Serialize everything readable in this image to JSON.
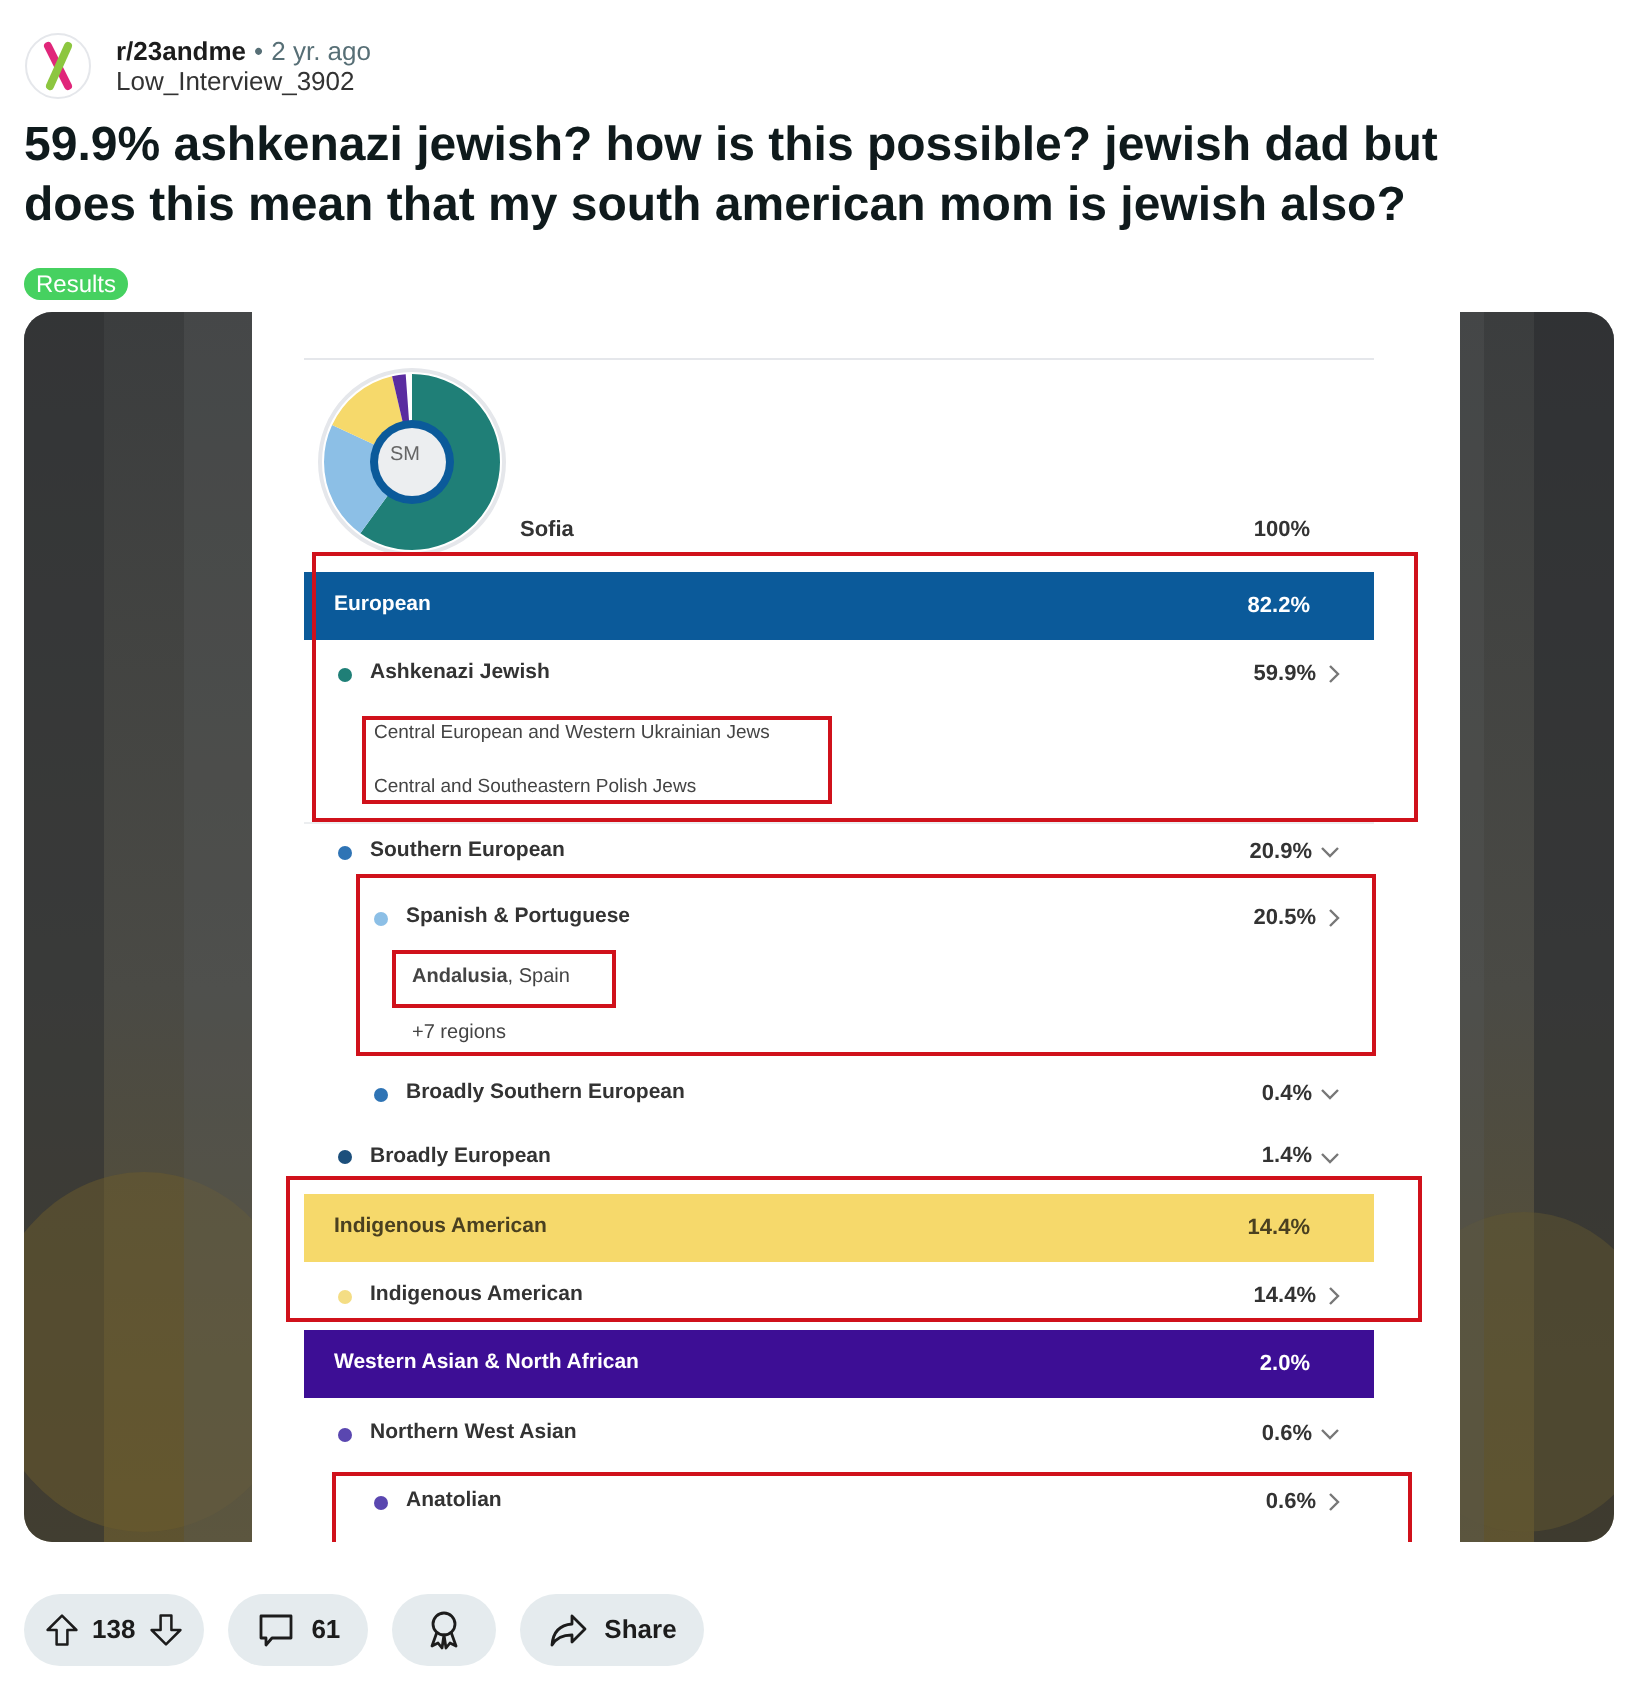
{
  "post": {
    "subreddit": "r/23andme",
    "separator": "•",
    "time": "2 yr. ago",
    "author": "Low_Interview_3902",
    "title": "59.9% ashkenazi jewish? how is this possible? jewish dad but does this mean that my south american mom is jewish also?",
    "flair": "Results"
  },
  "screenshot": {
    "initials": "SM",
    "name": "Sofia",
    "total": "100%",
    "sections": [
      {
        "label": "European",
        "percent": "82.2%",
        "color": "#0b5a9a",
        "light_text": true,
        "children": [
          {
            "kind": "population",
            "label": "Ashkenazi Jewish",
            "percent": "59.9%",
            "color": "#1f7f77",
            "expanded": false,
            "children": [
              {
                "kind": "region",
                "label": "Central European and Western Ukrainian Jews"
              },
              {
                "kind": "region",
                "label": "Central and Southeastern Polish Jews"
              }
            ]
          },
          {
            "kind": "population",
            "label": "Southern European",
            "percent": "20.9%",
            "color": "#2f74b5",
            "expanded": true,
            "children": [
              {
                "kind": "population",
                "label": "Spanish & Portuguese",
                "percent": "20.5%",
                "color": "#8cbfe6",
                "expanded": false,
                "children": [
                  {
                    "kind": "place",
                    "label": "**Andalusia**, Spain"
                  },
                  {
                    "kind": "more",
                    "label": "+7 regions"
                  }
                ]
              },
              {
                "kind": "population",
                "label": "Broadly Southern European",
                "percent": "0.4%",
                "color": "#2f74b5",
                "expanded": true
              }
            ]
          },
          {
            "kind": "population",
            "label": "Broadly European",
            "percent": "1.4%",
            "color": "#1c4f7c",
            "expanded": true
          }
        ]
      },
      {
        "label": "Indigenous American",
        "percent": "14.4%",
        "color": "#f6d96b",
        "light_text": false,
        "children": [
          {
            "kind": "population",
            "label": "Indigenous American",
            "percent": "14.4%",
            "color": "#f4dd84",
            "expanded": false
          }
        ]
      },
      {
        "label": "Western Asian & North African",
        "percent": "2.0%",
        "color": "#3d0e95",
        "light_text": true,
        "children": [
          {
            "kind": "population",
            "label": "Northern West Asian",
            "percent": "0.6%",
            "color": "#5a47b0",
            "expanded": true,
            "children": [
              {
                "kind": "population",
                "label": "Anatolian",
                "percent": "0.6%",
                "color": "#5a47b0",
                "expanded": false
              }
            ]
          }
        ]
      }
    ]
  },
  "actions": {
    "votes": "138",
    "comments": "61",
    "share": "Share"
  }
}
